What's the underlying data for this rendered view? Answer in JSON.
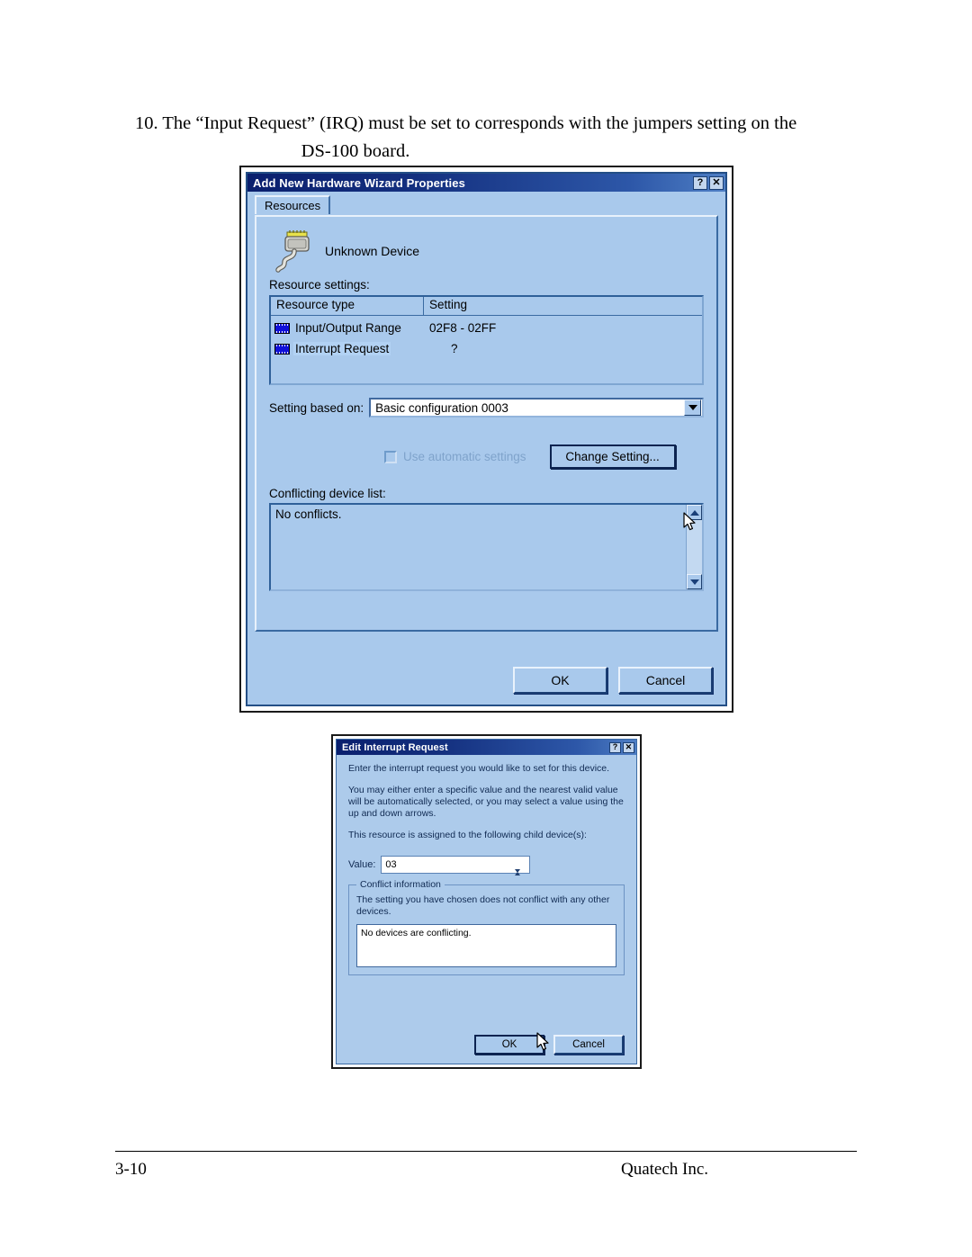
{
  "page": {
    "instruction_line1": "10. The “Input Request” (IRQ) must be set to  corresponds with the jumpers setting on the",
    "instruction_line2": "DS-100 board.",
    "footer_page": "3-10",
    "footer_company": "Quatech Inc."
  },
  "colors": {
    "dialog_face": "#a9c9ec",
    "titlebar_start": "#0a1f6e",
    "titlebar_end": "#4e7ec4",
    "selection": "#b2d2f4",
    "disabled_text": "#7fa3cb",
    "chip_blue": "#1010d8"
  },
  "dialog1": {
    "title": "Add New Hardware Wizard Properties",
    "help_button": "?",
    "close_button": "✕",
    "tabs": [
      {
        "label": "Resources",
        "selected": true
      }
    ],
    "device_name": "Unknown Device",
    "device_icon": "plug-icon",
    "resource_settings_label": "Resource settings:",
    "resource_table": {
      "columns": [
        "Resource type",
        "Setting"
      ],
      "rows": [
        {
          "icon": "chip-icon",
          "type": "Input/Output Range",
          "setting": "02F8 - 02FF",
          "selected": false
        },
        {
          "icon": "chip-icon",
          "type": "Interrupt Request",
          "setting": "?",
          "selected": true
        }
      ]
    },
    "setting_based_on_label": "Setting based on:",
    "setting_based_on_value": "Basic configuration 0003",
    "use_automatic_settings_label": "Use automatic settings",
    "use_automatic_settings_checked": false,
    "use_automatic_settings_disabled": true,
    "change_setting_label": "Change Setting...",
    "conflicting_device_list_label": "Conflicting device list:",
    "conflicting_device_list_text": "No conflicts.",
    "scroll_up": "▲",
    "scroll_down": "▼",
    "ok_label": "OK",
    "cancel_label": "Cancel"
  },
  "dialog2": {
    "title": "Edit Interrupt Request",
    "help_button": "?",
    "close_button": "✕",
    "paragraph1": "Enter the interrupt request you would like to set for this device.",
    "paragraph2": "You may either enter a specific value and the nearest valid value will be automatically selected, or you may select a value using the up and down arrows.",
    "paragraph3": "This resource is assigned to the following child device(s):",
    "value_label": "Value:",
    "value": "03",
    "spin_up": "▲",
    "spin_down": "▼",
    "conflict_group_title": "Conflict information",
    "conflict_text": "The setting you have chosen does not conflict with any other devices.",
    "conflict_listbox_text": "No devices are conflicting.",
    "ok_label": "OK",
    "cancel_label": "Cancel"
  }
}
